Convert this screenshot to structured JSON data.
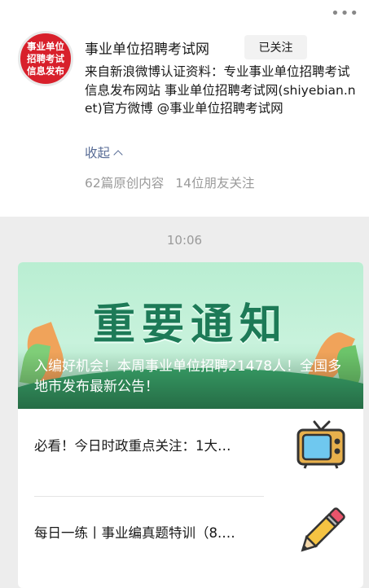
{
  "header": {
    "more_icon": "more-dots-icon",
    "avatar_text": "事业单位招聘考试信息发布",
    "account_name": "事业单位招聘考试网",
    "follow_label": "已关注",
    "description": "来自新浪微博认证资料：专业事业单位招聘考试信息发布网站 事业单位招聘考试网(shiyebian.net)官方微博 @事业单位招聘考试网",
    "collapse_label": "收起",
    "original_count": "62篇原创内容",
    "friends_following": "14位朋友关注"
  },
  "message": {
    "time": "10:06",
    "cover_text": "重要通知",
    "cover_title": "入编好机会！本周事业单位招聘21478人！全国多地市发布最新公告！",
    "items": [
      {
        "title": "必看！今日时政重点关注：1大…",
        "icon": "tv-icon"
      },
      {
        "title": "每日一练丨事业编真题特训（8.…",
        "icon": "pencil-icon"
      }
    ]
  },
  "colors": {
    "link": "#576b95",
    "avatar_bg": "#d8202b",
    "cover_green": "#1d7a57"
  }
}
